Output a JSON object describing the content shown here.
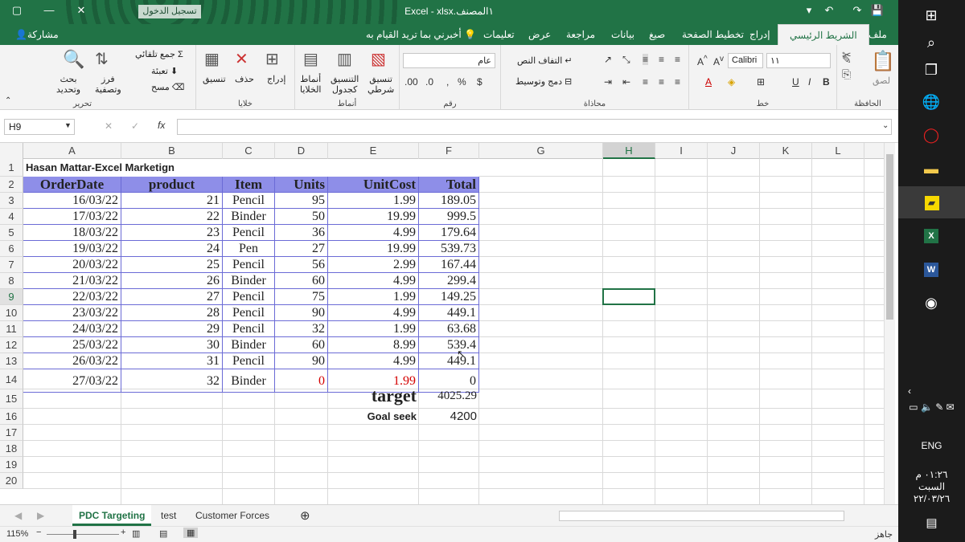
{
  "title_bar": {
    "title": "Excel  -  xlsx.١المصنف",
    "sign_in": "تسجيل الدخول"
  },
  "tabs": [
    "ملف",
    "الشريط الرئيسي",
    "إدراج",
    "تخطيط الصفحة",
    "صيغ",
    "بيانات",
    "مراجعة",
    "عرض",
    "تعليمات",
    "أخبرني بما تريد القيام به",
    "مشاركة"
  ],
  "ribbon": {
    "clipboard": {
      "paste": "لصق",
      "group": "الحافظة"
    },
    "font": {
      "name": "Calibri",
      "size": "١١",
      "group": "خط"
    },
    "alignment": {
      "wrap": "التفاف النص",
      "merge": "دمج وتوسيط",
      "group": "محاذاة"
    },
    "number": {
      "format": "عام",
      "group": "رقم"
    },
    "styles": {
      "conditional": "تنسيق\nشرطي",
      "as_table": "التنسيق\nكجدول",
      "cell_styles": "أنماط\nالخلايا",
      "group": "أنماط"
    },
    "cells": {
      "insert": "إدراج",
      "delete": "حذف",
      "format": "تنسيق",
      "group": "خلايا"
    },
    "editing": {
      "autosum": "جمع تلقائي",
      "fill": "تعبئة",
      "clear": "مسح",
      "sort": "فرز\nوتصفية",
      "find": "بحث\nوتحديد",
      "group": "تحرير"
    }
  },
  "formula_bar": {
    "name_box": "H9",
    "fx": "fx",
    "content": ""
  },
  "columns": [
    "A",
    "B",
    "C",
    "D",
    "E",
    "F",
    "G",
    "H",
    "I",
    "J",
    "K",
    "L"
  ],
  "rows": [
    "1",
    "2",
    "3",
    "4",
    "5",
    "6",
    "7",
    "8",
    "9",
    "10",
    "11",
    "12",
    "13",
    "14",
    "15",
    "16",
    "17",
    "18",
    "19",
    "20"
  ],
  "sheet": {
    "title": "Hasan Mattar-Excel Marketign",
    "headers": [
      "OrderDate",
      "product",
      "Item",
      "Units",
      "UnitCost",
      "Total"
    ],
    "data": [
      [
        "16/03/22",
        "21",
        "Pencil",
        "95",
        "1.99",
        "189.05"
      ],
      [
        "17/03/22",
        "22",
        "Binder",
        "50",
        "19.99",
        "999.5"
      ],
      [
        "18/03/22",
        "23",
        "Pencil",
        "36",
        "4.99",
        "179.64"
      ],
      [
        "19/03/22",
        "24",
        "Pen",
        "27",
        "19.99",
        "539.73"
      ],
      [
        "20/03/22",
        "25",
        "Pencil",
        "56",
        "2.99",
        "167.44"
      ],
      [
        "21/03/22",
        "26",
        "Binder",
        "60",
        "4.99",
        "299.4"
      ],
      [
        "22/03/22",
        "27",
        "Pencil",
        "75",
        "1.99",
        "149.25"
      ],
      [
        "23/03/22",
        "28",
        "Pencil",
        "90",
        "4.99",
        "449.1"
      ],
      [
        "24/03/22",
        "29",
        "Pencil",
        "32",
        "1.99",
        "63.68"
      ],
      [
        "25/03/22",
        "30",
        "Binder",
        "60",
        "8.99",
        "539.4"
      ],
      [
        "26/03/22",
        "31",
        "Pencil",
        "90",
        "4.99",
        "449.1"
      ],
      [
        "27/03/22",
        "32",
        "Binder",
        "0",
        "1.99",
        "0"
      ]
    ],
    "target_label": "target",
    "target_value": "4025.29",
    "goal_label": "Goal seek",
    "goal_value": "4200",
    "highlight_color": "#d40000",
    "header_fill": "#8e8ee8"
  },
  "sheet_tabs": [
    "PDC Targeting",
    "test",
    "Customer Forces"
  ],
  "status": {
    "zoom": "115%",
    "ready": "جاهز"
  },
  "taskbar": {
    "lang": "ENG",
    "time": "٠١:٢٦ م",
    "day": "السبت",
    "date": "٢٢/٠٣/٢٦"
  }
}
